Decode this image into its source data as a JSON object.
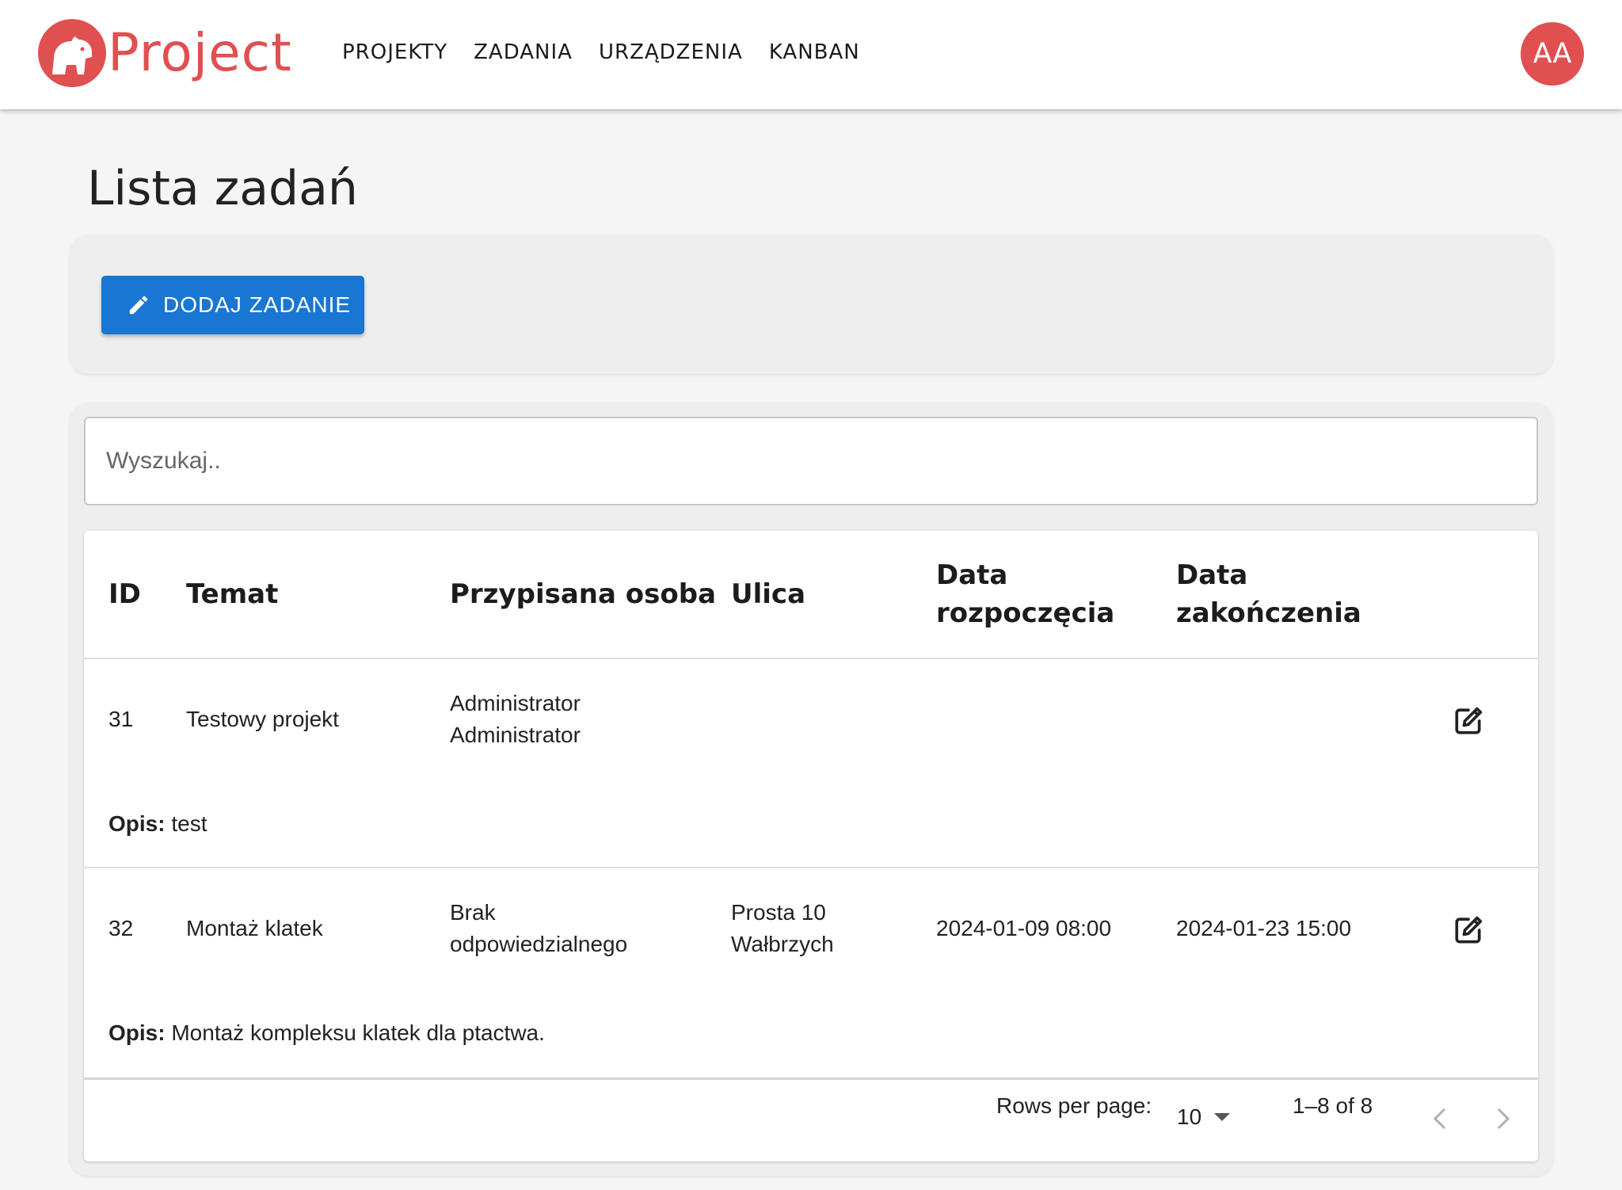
{
  "brand": {
    "name": "Project"
  },
  "nav": [
    {
      "label": "PROJEKTY"
    },
    {
      "label": "ZADANIA"
    },
    {
      "label": "URZĄDZENIA"
    },
    {
      "label": "KANBAN"
    }
  ],
  "user": {
    "initials": "AA"
  },
  "page": {
    "title": "Lista zadań"
  },
  "actions": {
    "add_label": "DODAJ ZADANIE"
  },
  "search": {
    "placeholder": "Wyszukaj.."
  },
  "table": {
    "headers": {
      "id": "ID",
      "subject": "Temat",
      "assignee": "Przypisana osoba",
      "street": "Ulica",
      "start_line1": "Data",
      "start_line2": "rozpoczęcia",
      "end_line1": "Data",
      "end_line2": "zakończenia"
    },
    "desc_label": "Opis:",
    "rows": [
      {
        "id": "31",
        "subject": "Testowy projekt",
        "assignee_line1": "Administrator",
        "assignee_line2": "Administrator",
        "street_line1": "",
        "street_line2": "",
        "start": "",
        "end": "",
        "desc": "test"
      },
      {
        "id": "32",
        "subject": "Montaż klatek",
        "assignee_line1": "Brak",
        "assignee_line2": "odpowiedzialnego",
        "street_line1": "Prosta 10",
        "street_line2": "Wałbrzych",
        "start": "2024-01-09 08:00",
        "end": "2024-01-23 15:00",
        "desc": "Montaż kompleksu klatek dla ptactwa."
      }
    ]
  },
  "pagination": {
    "rows_per_page_label": "Rows per page:",
    "rows_per_page": "10",
    "range": "1–8 of 8"
  },
  "colors": {
    "brand": "#e05050",
    "primary": "#1976d2",
    "background": "#f5f5f5"
  },
  "icons": {
    "logo": "capybara-icon",
    "add": "pencil-icon",
    "edit": "edit-square-icon",
    "dropdown": "caret-down-icon",
    "prev": "chevron-left-icon",
    "next": "chevron-right-icon"
  }
}
